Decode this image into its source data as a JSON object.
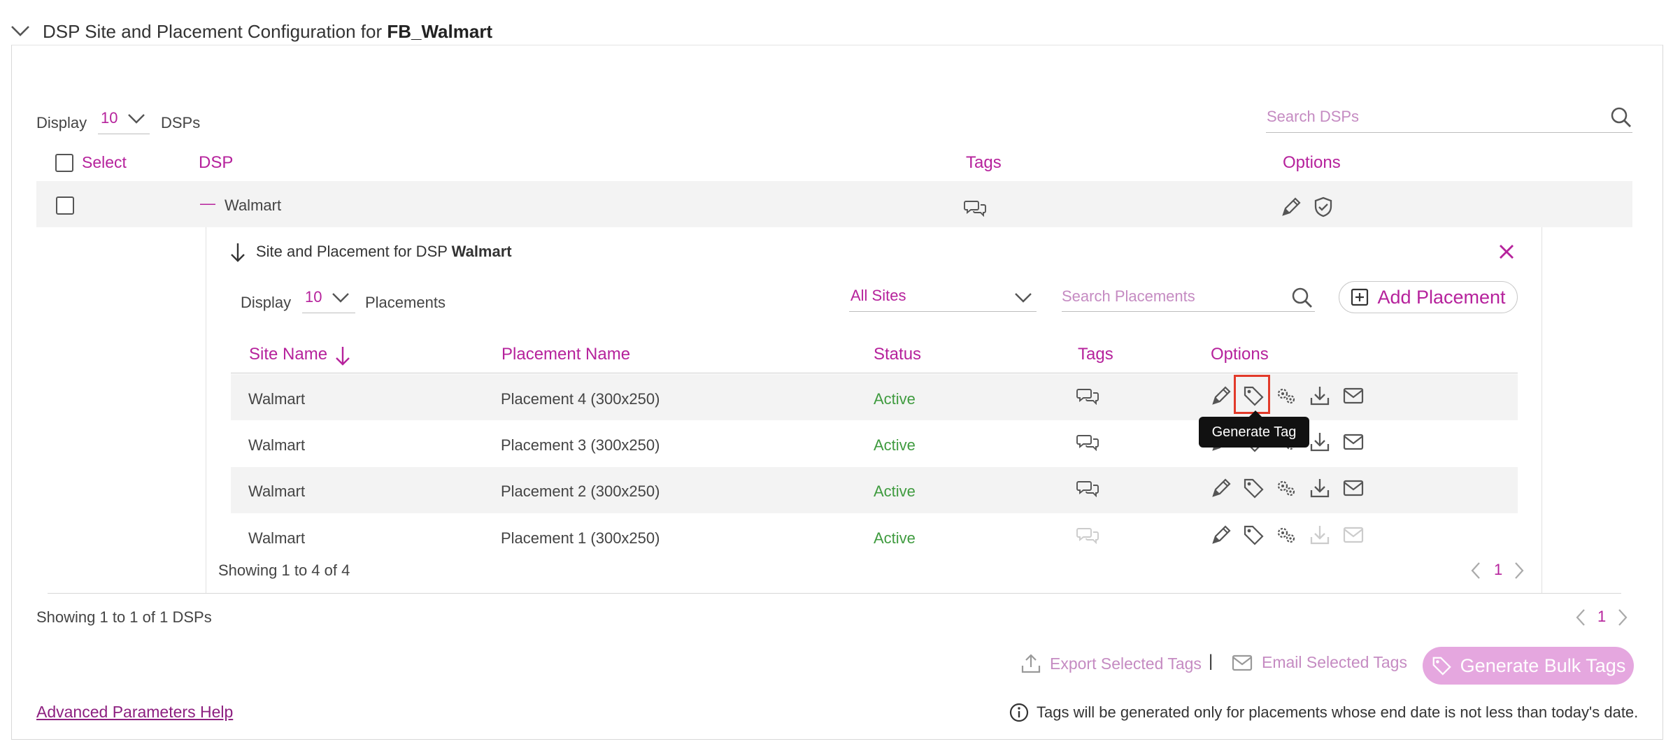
{
  "section": {
    "title_prefix": "DSP Site and Placement Configuration for ",
    "title_bold": "FB_Walmart"
  },
  "dsp": {
    "display_label": "Display",
    "display_value": "10",
    "display_suffix": "DSPs",
    "search_placeholder": "Search DSPs",
    "columns": {
      "select": "Select",
      "dsp": "DSP",
      "tags": "Tags",
      "options": "Options"
    },
    "row": {
      "name": "Walmart",
      "expander": "—"
    },
    "showing": "Showing 1 to 1 of 1 DSPs",
    "page": "1"
  },
  "placements": {
    "title_prefix": "Site and Placement for DSP ",
    "title_bold": "Walmart",
    "display_label": "Display",
    "display_value": "10",
    "display_suffix": "Placements",
    "site_filter": "All Sites",
    "search_placeholder": "Search Placements",
    "add_button": "Add Placement",
    "columns": {
      "site": "Site Name",
      "placement": "Placement Name",
      "status": "Status",
      "tags": "Tags",
      "options": "Options"
    },
    "rows": [
      {
        "site": "Walmart",
        "placement": "Placement 4 (300x250)",
        "status": "Active"
      },
      {
        "site": "Walmart",
        "placement": "Placement 3 (300x250)",
        "status": "Active"
      },
      {
        "site": "Walmart",
        "placement": "Placement 2 (300x250)",
        "status": "Active"
      },
      {
        "site": "Walmart",
        "placement": "Placement 1 (300x250)",
        "status": "Active"
      }
    ],
    "showing": "Showing 1 to 4 of 4",
    "page": "1"
  },
  "tooltip": "Generate Tag",
  "footer": {
    "help_link": "Advanced Parameters Help",
    "export_tags": "Export Selected Tags",
    "separator": "|",
    "email_tags": "Email Selected Tags",
    "bulk_button": "Generate Bulk Tags",
    "note": "Tags will be generated only for placements whose end date is not less than today's date."
  },
  "colors": {
    "accent": "#b6229c",
    "active": "#3f9b3f",
    "tooltip_bg": "#111111",
    "highlight": "#e23a2a"
  }
}
